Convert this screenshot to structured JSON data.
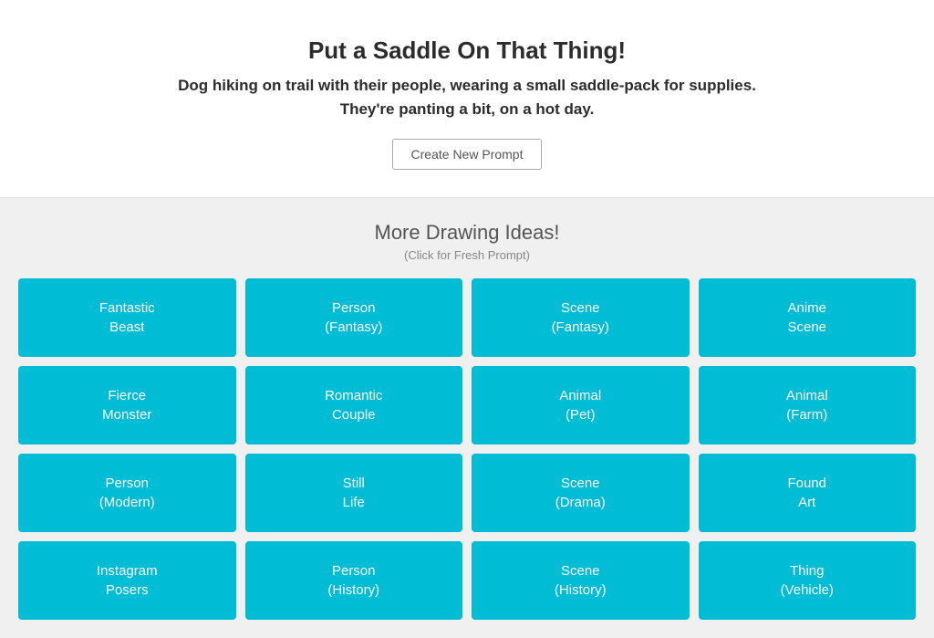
{
  "header": {
    "title": "Put a Saddle On That Thing!",
    "subtitle_line1": "Dog hiking on trail with their people, wearing a small saddle-pack for supplies.",
    "subtitle_line2": "They're panting a bit, on a hot day.",
    "create_button_label": "Create New Prompt"
  },
  "drawing_ideas": {
    "section_title": "More Drawing Ideas!",
    "section_subtitle": "(Click for Fresh Prompt)",
    "cards": [
      {
        "label": "Fantastic\nBeast"
      },
      {
        "label": "Person\n(Fantasy)"
      },
      {
        "label": "Scene\n(Fantasy)"
      },
      {
        "label": "Anime\nScene"
      },
      {
        "label": "Fierce\nMonster"
      },
      {
        "label": "Romantic\nCouple"
      },
      {
        "label": "Animal\n(Pet)"
      },
      {
        "label": "Animal\n(Farm)"
      },
      {
        "label": "Person\n(Modern)"
      },
      {
        "label": "Still\nLife"
      },
      {
        "label": "Scene\n(Drama)"
      },
      {
        "label": "Found\nArt"
      },
      {
        "label": "Instagram\nPosers"
      },
      {
        "label": "Person\n(History)"
      },
      {
        "label": "Scene\n(History)"
      },
      {
        "label": "Thing\n(Vehicle)"
      }
    ]
  }
}
